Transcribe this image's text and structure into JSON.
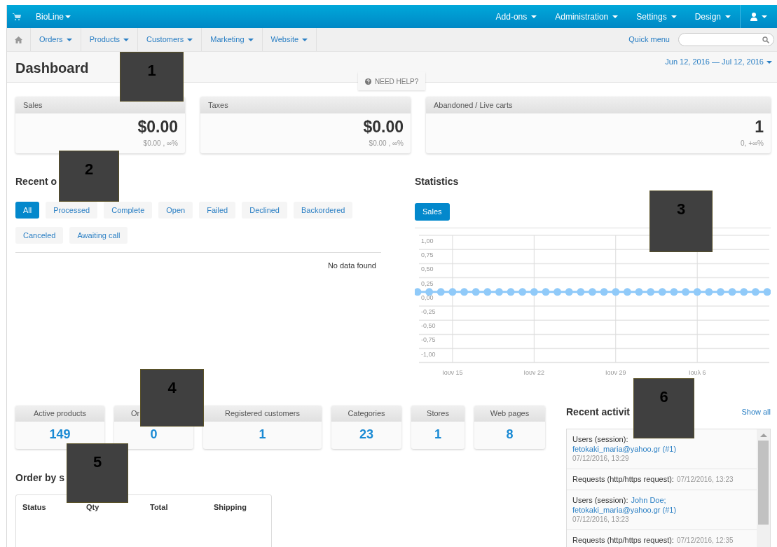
{
  "topbar": {
    "store": "BioLine",
    "menus": [
      "Add-ons",
      "Administration",
      "Settings",
      "Design"
    ]
  },
  "nav": {
    "items": [
      "Orders",
      "Products",
      "Customers",
      "Marketing",
      "Website"
    ],
    "quick_menu": "Quick menu"
  },
  "header": {
    "title": "Dashboard",
    "date_range": "Jun 12, 2016 — Jul 12, 2016",
    "help": "NEED HELP?"
  },
  "summary_cards": [
    {
      "title": "Sales",
      "value": "$0.00",
      "detail": "$0.00 , ∞%"
    },
    {
      "title": "Taxes",
      "value": "$0.00",
      "detail": "$0.00 , ∞%"
    },
    {
      "title": "Abandoned / Live carts",
      "value": "1",
      "detail": "0, +∞%"
    }
  ],
  "recent_orders": {
    "title": "Recent o",
    "tabs": [
      {
        "label": "All",
        "selected": true
      },
      {
        "label": "Processed",
        "selected": false
      },
      {
        "label": "Complete",
        "selected": false
      },
      {
        "label": "Open",
        "selected": false
      },
      {
        "label": "Failed",
        "selected": false
      },
      {
        "label": "Declined",
        "selected": false
      },
      {
        "label": "Backordered",
        "selected": false
      },
      {
        "label": "Canceled",
        "selected": false
      },
      {
        "label": "Awaiting call",
        "selected": false
      }
    ],
    "empty": "No data found"
  },
  "statistics": {
    "title": "Statistics",
    "tabs": [
      {
        "label": "Sales",
        "selected": true
      }
    ],
    "chart_data": {
      "type": "line",
      "categories": [
        null,
        null,
        null,
        "Ιουν 15",
        null,
        null,
        null,
        null,
        null,
        null,
        "Ιουν 22",
        null,
        null,
        null,
        null,
        null,
        null,
        "Ιουν 29",
        null,
        null,
        null,
        null,
        null,
        null,
        "Ιουλ 6",
        null,
        null,
        null,
        null,
        null,
        null
      ],
      "grid": true,
      "series": [
        {
          "color": "#90caf9",
          "marker": true,
          "values": [
            0,
            0,
            0,
            0,
            0,
            0,
            0,
            0,
            0,
            0,
            0,
            0,
            0,
            0,
            0,
            0,
            0,
            0,
            0,
            0,
            0,
            0,
            0,
            0,
            0,
            0,
            0,
            0,
            0,
            0,
            0
          ]
        }
      ],
      "ylim": [
        -1,
        1
      ],
      "yticks": [
        {
          "value": 1,
          "label": "1,00"
        },
        {
          "value": 0.75,
          "label": "0,75"
        },
        {
          "value": 0.5,
          "label": "0,50"
        },
        {
          "value": 0.25,
          "label": "0,25"
        },
        {
          "value": 0,
          "label": "0,00"
        },
        {
          "value": -0.25,
          "label": "-0,25"
        },
        {
          "value": -0.5,
          "label": "-0,50"
        },
        {
          "value": -0.75,
          "label": "-0,75"
        },
        {
          "value": -1,
          "label": "-1,00"
        }
      ]
    }
  },
  "counters": [
    {
      "label": "Active products",
      "value": "149"
    },
    {
      "label": "Or",
      "value": "0"
    },
    {
      "label": "Registered customers",
      "value": "1"
    },
    {
      "label": "Categories",
      "value": "23"
    },
    {
      "label": "Stores",
      "value": "1"
    },
    {
      "label": "Web pages",
      "value": "8"
    }
  ],
  "order_by_status": {
    "title": "Order by s",
    "columns": [
      "Status",
      "Qty",
      "Total",
      "Shipping"
    ]
  },
  "recent_activity": {
    "title": "Recent activit",
    "show_all": "Show all",
    "items": [
      {
        "kind": "user",
        "label": "Users (session):",
        "detail": "fetokaki_maria@yahoo.gr (#1)",
        "time": "07/12/2016, 13:29"
      },
      {
        "kind": "request",
        "label": "Requests (http/https request):",
        "time": "07/12/2016, 13:23"
      },
      {
        "kind": "user",
        "label": "Users (session):",
        "link": "John Doe;",
        "detail": "fetokaki_maria@yahoo.gr (#1)",
        "time": "07/12/2016, 13:23"
      },
      {
        "kind": "request",
        "label": "Requests (http/https request):",
        "time": "07/12/2016, 12:35"
      }
    ]
  },
  "annotations": [
    {
      "label": "1"
    },
    {
      "label": "2"
    },
    {
      "label": "3"
    },
    {
      "label": "4"
    },
    {
      "label": "5"
    },
    {
      "label": "6"
    }
  ]
}
